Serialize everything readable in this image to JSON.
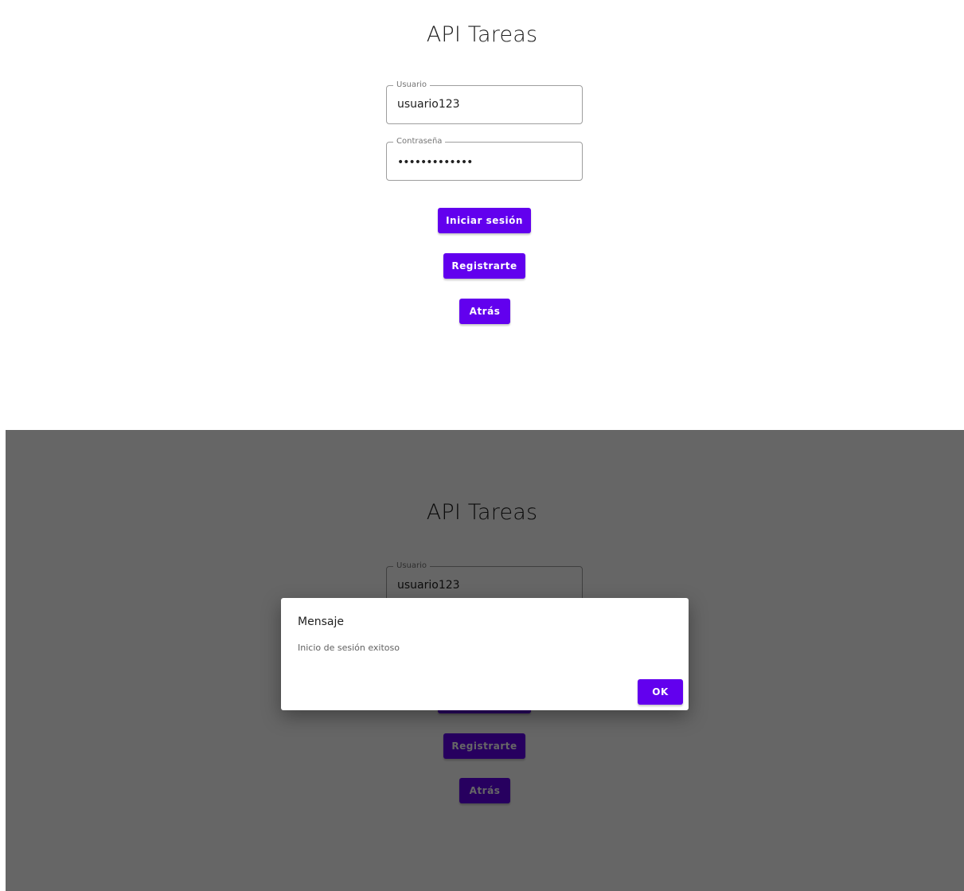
{
  "app": {
    "title": "API Tareas"
  },
  "form": {
    "username": {
      "label": "Usuario",
      "value": "usuario123"
    },
    "password": {
      "label": "Contraseña",
      "masked_value": "•••••••••••••"
    }
  },
  "buttons": {
    "login": "Iniciar sesión",
    "register": "Registrarte",
    "back": "Atrás"
  },
  "dialog": {
    "title": "Mensaje",
    "message": "Inicio de sesión exitoso",
    "ok_label": "OK"
  },
  "colors": {
    "primary": "#6200ee",
    "overlay": "rgba(0,0,0,0.6)"
  }
}
